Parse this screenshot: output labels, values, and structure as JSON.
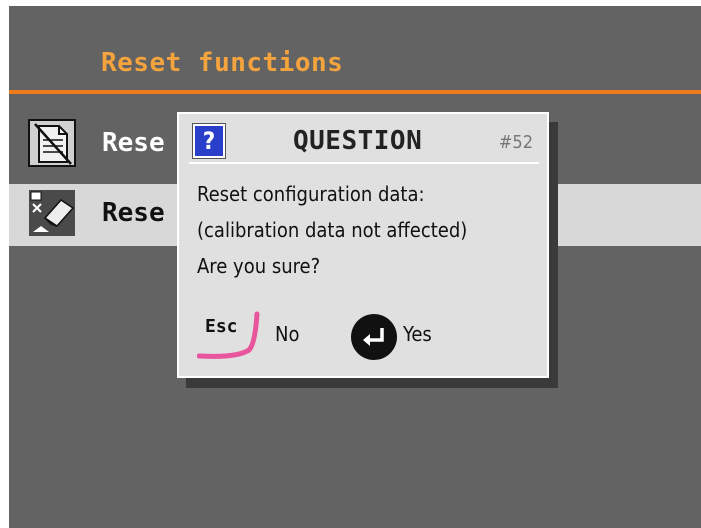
{
  "header": {
    "title": "Reset functions"
  },
  "menu": {
    "items": [
      {
        "label": "Rese",
        "icon": "document-crossed-icon",
        "selected": false
      },
      {
        "label": "Rese",
        "icon": "eraser-icon",
        "selected": true
      }
    ]
  },
  "dialog": {
    "icon": "question-icon",
    "icon_glyph": "?",
    "title": "QUESTION",
    "code": "#52",
    "lines": [
      "Reset configuration data:",
      "(calibration data not affected)",
      "Are you sure?"
    ],
    "esc_key": "Esc",
    "no_label": "No",
    "yes_label": "Yes"
  },
  "colors": {
    "background": "#636363",
    "header_title": "#f5a33c",
    "header_rule": "#ef7b1c",
    "selected_row": "#d8d8d8",
    "dialog_bg": "#e0e0e0",
    "question_icon_bg": "#2a3fc9",
    "esc_swoosh": "#e8559c"
  }
}
